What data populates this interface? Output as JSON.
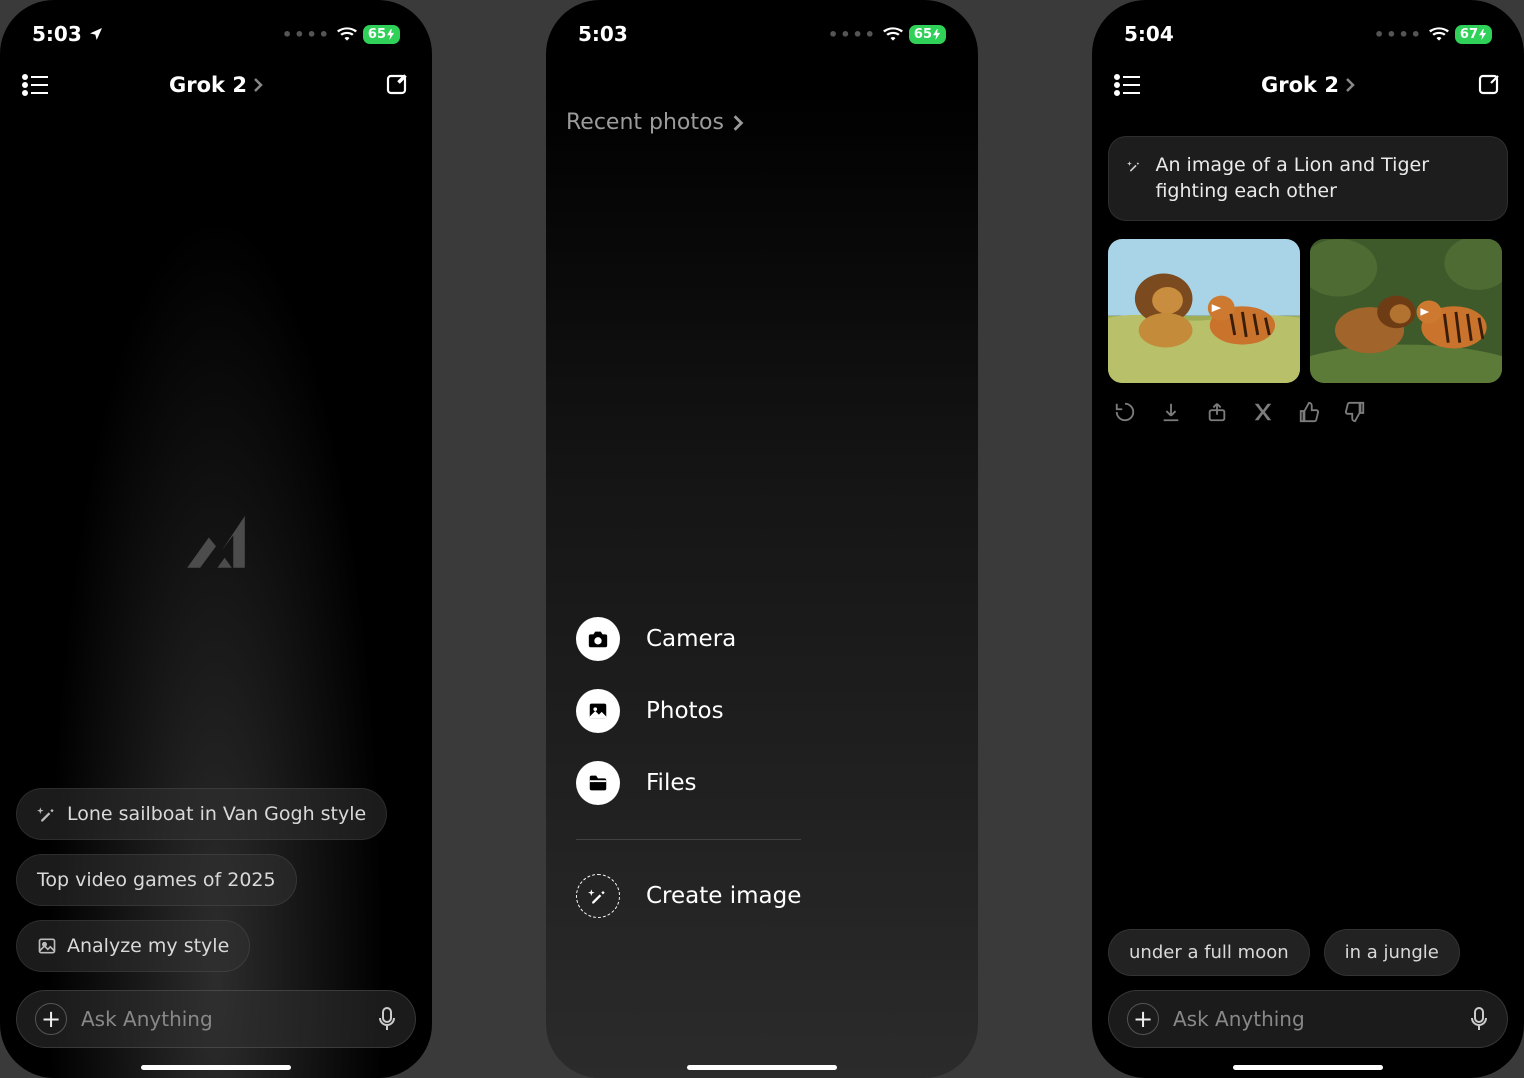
{
  "screens": {
    "s1": {
      "status": {
        "time": "5:03",
        "battery": "65"
      },
      "header": {
        "title": "Grok 2"
      },
      "suggestions": [
        {
          "icon": "wand-icon",
          "label": "Lone sailboat in Van Gogh style"
        },
        {
          "icon": null,
          "label": "Top video games of 2025"
        },
        {
          "icon": "image-icon",
          "label": "Analyze my style"
        }
      ],
      "input": {
        "placeholder": "Ask Anything"
      }
    },
    "s2": {
      "status": {
        "time": "5:03",
        "battery": "65"
      },
      "recent_label": "Recent photos",
      "actions": [
        {
          "icon": "camera-icon",
          "label": "Camera"
        },
        {
          "icon": "photos-icon",
          "label": "Photos"
        },
        {
          "icon": "files-icon",
          "label": "Files"
        },
        {
          "icon": "wand-icon",
          "label": "Create image",
          "dashed": true
        }
      ]
    },
    "s3": {
      "status": {
        "time": "5:04",
        "battery": "67"
      },
      "header": {
        "title": "Grok 2"
      },
      "prompt_text": "An image of a Lion and Tiger fighting each other",
      "toolbar_icons": [
        "refresh",
        "download",
        "share",
        "x-logo",
        "thumbs-up",
        "thumbs-down"
      ],
      "followups": [
        {
          "label": "under a full moon"
        },
        {
          "label": "in a jungle"
        }
      ],
      "input": {
        "placeholder": "Ask Anything"
      }
    }
  }
}
